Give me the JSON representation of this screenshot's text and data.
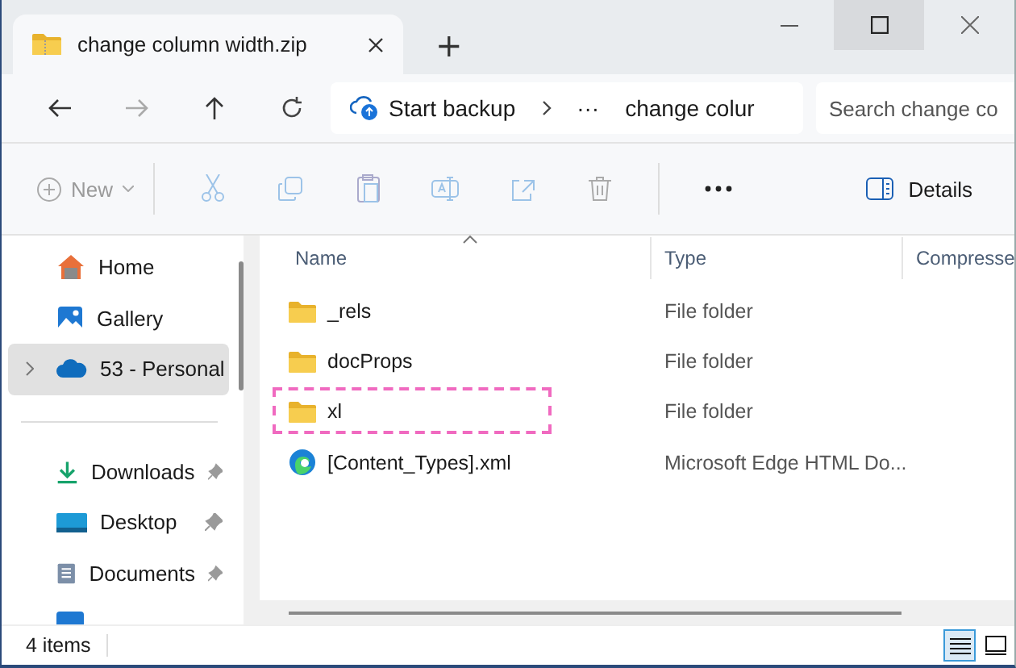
{
  "tab": {
    "title": "change column width.zip",
    "new_tab": "+"
  },
  "nav": {
    "breadcrumb": [
      {
        "kind": "backup",
        "label": "Start backup"
      },
      {
        "kind": "more",
        "label": "···"
      },
      {
        "kind": "folder",
        "label": "change colur"
      }
    ],
    "search": {
      "placeholder": "Search change co"
    }
  },
  "toolbar": {
    "new_label": "New",
    "details_label": "Details"
  },
  "sidebar": {
    "items": [
      {
        "kind": "home",
        "label": "Home",
        "selected": false,
        "expandable": false,
        "pinned": false
      },
      {
        "kind": "gallery",
        "label": "Gallery",
        "selected": false,
        "expandable": false,
        "pinned": false
      },
      {
        "kind": "cloud",
        "label": "53 - Personal",
        "selected": true,
        "expandable": true,
        "pinned": false
      },
      {
        "kind": "divider"
      },
      {
        "kind": "downloads",
        "label": "Downloads",
        "selected": false,
        "expandable": false,
        "pinned": true
      },
      {
        "kind": "desktop",
        "label": "Desktop",
        "selected": false,
        "expandable": false,
        "pinned": true
      },
      {
        "kind": "documents",
        "label": "Documents",
        "selected": false,
        "expandable": false,
        "pinned": true
      }
    ]
  },
  "table": {
    "columns": [
      "Name",
      "Type",
      "Compresse"
    ],
    "rows": [
      {
        "kind": "folder",
        "name": "_rels",
        "type": "File folder",
        "highlighted": false
      },
      {
        "kind": "folder",
        "name": "docProps",
        "type": "File folder",
        "highlighted": false
      },
      {
        "kind": "folder",
        "name": "xl",
        "type": "File folder",
        "highlighted": true
      },
      {
        "kind": "edge",
        "name": "[Content_Types].xml",
        "type": "Microsoft Edge HTML Do...",
        "highlighted": false
      }
    ]
  },
  "status_bar": {
    "count": "4 items",
    "views": [
      {
        "kind": "details",
        "selected": true
      },
      {
        "kind": "tiles",
        "selected": false
      }
    ]
  }
}
